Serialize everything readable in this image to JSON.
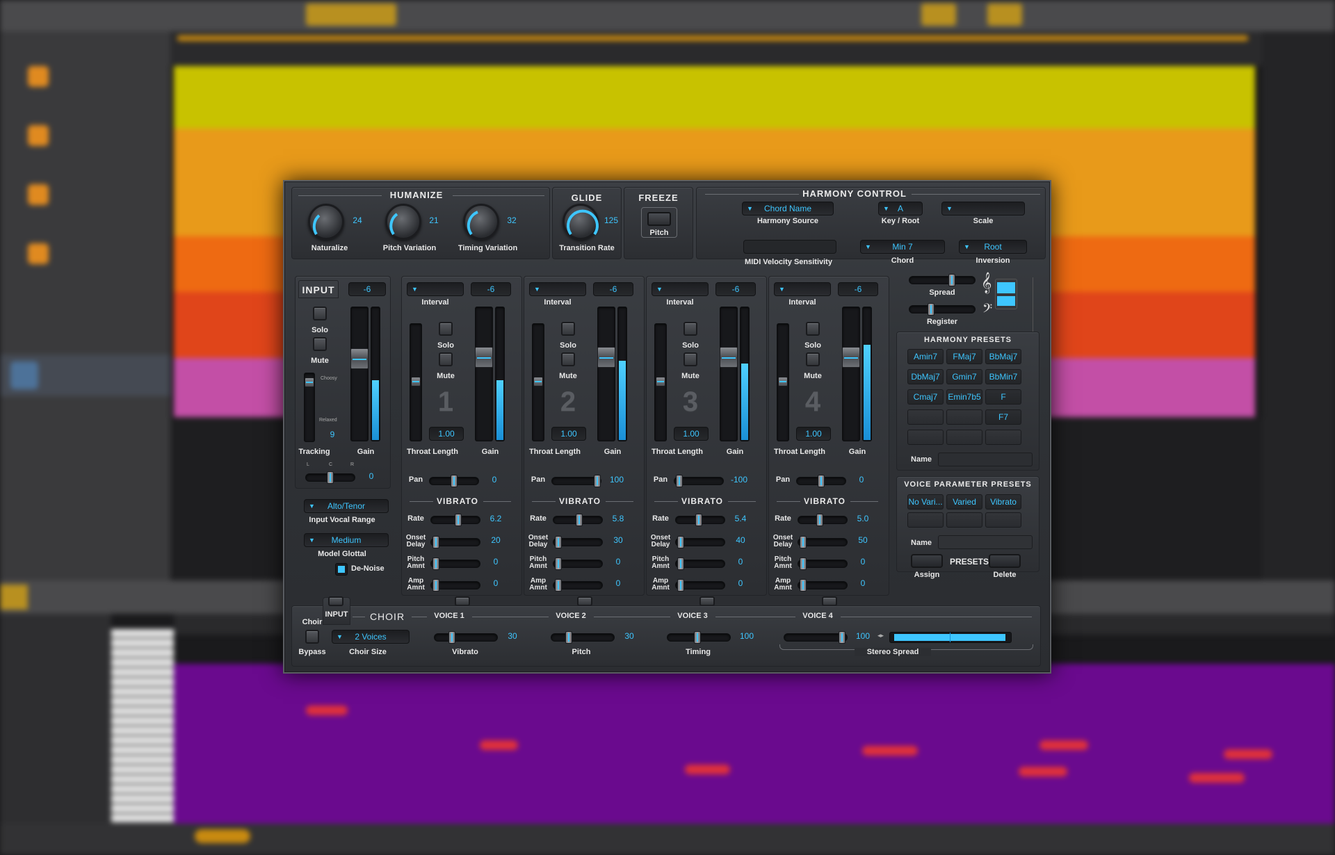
{
  "humanize": {
    "title": "HUMANIZE",
    "knobs": [
      {
        "label": "Naturalize",
        "value": "24"
      },
      {
        "label": "Pitch Variation",
        "value": "21"
      },
      {
        "label": "Timing Variation",
        "value": "32"
      }
    ]
  },
  "glide": {
    "title": "GLIDE",
    "label": "Transition Rate",
    "value": "125"
  },
  "freeze": {
    "title": "FREEZE",
    "label": "Pitch"
  },
  "harmony": {
    "title": "HARMONY CONTROL",
    "source": {
      "value": "Chord Name",
      "label": "Harmony Source"
    },
    "key": {
      "value": "A",
      "label": "Key / Root"
    },
    "scale": {
      "value": "",
      "label": "Scale"
    },
    "midi_label": "MIDI Velocity Sensitivity",
    "chord": {
      "value": "Min 7",
      "label": "Chord"
    },
    "inversion": {
      "value": "Root",
      "label": "Inversion"
    },
    "spread_label": "Spread",
    "register_label": "Register"
  },
  "input": {
    "title": "INPUT",
    "gain_value": "-6",
    "solo": "Solo",
    "mute": "Mute",
    "choosy": "Choosy",
    "relaxed": "Relaxed",
    "tracking_value": "9",
    "tracking_label": "Tracking",
    "gain_label": "Gain",
    "pan_value": "0",
    "vocal_range": {
      "value": "Alto/Tenor",
      "label": "Input Vocal Range"
    },
    "model": {
      "value": "Medium",
      "label": "Model Glottal"
    },
    "denoise": "De-Noise",
    "lcr": [
      "L",
      "C",
      "R"
    ]
  },
  "voices": [
    {
      "num": "1",
      "gain": "-6",
      "throat": "1.00",
      "pan": "0",
      "rate": "6.2",
      "onset": "20",
      "pitch_amnt": "0",
      "amp_amnt": "0",
      "gain_level": 0.45
    },
    {
      "num": "2",
      "gain": "-6",
      "throat": "1.00",
      "pan": "100",
      "rate": "5.8",
      "onset": "30",
      "pitch_amnt": "0",
      "amp_amnt": "0",
      "gain_level": 0.6
    },
    {
      "num": "3",
      "gain": "-6",
      "throat": "1.00",
      "pan": "-100",
      "rate": "5.4",
      "onset": "40",
      "pitch_amnt": "0",
      "amp_amnt": "0",
      "gain_level": 0.58
    },
    {
      "num": "4",
      "gain": "-6",
      "throat": "1.00",
      "pan": "0",
      "rate": "5.0",
      "onset": "50",
      "pitch_amnt": "0",
      "amp_amnt": "0",
      "gain_level": 0.72
    }
  ],
  "voice_labels": {
    "interval": "Interval",
    "solo": "Solo",
    "mute": "Mute",
    "throat": "Throat Length",
    "gain": "Gain",
    "pan": "Pan",
    "vibrato": "VIBRATO",
    "rate": "Rate",
    "onset1": "Onset",
    "onset2": "Delay",
    "pitch1": "Pitch",
    "pitch2": "Amnt",
    "amp1": "Amp",
    "amp2": "Amnt"
  },
  "harmony_presets": {
    "title": "HARMONY PRESETS",
    "items": [
      "Amin7",
      "FMaj7",
      "BbMaj7",
      "DbMaj7",
      "Gmin7",
      "BbMin7",
      "Cmaj7",
      "Emin7b5",
      "F",
      "",
      "",
      "F7",
      "",
      "",
      ""
    ],
    "name_label": "Name"
  },
  "voice_param_presets": {
    "title": "VOICE PARAMETER PRESETS",
    "items": [
      "No Vari...",
      "Varied",
      "Vibrato",
      "",
      "",
      ""
    ],
    "name_label": "Name",
    "assign": "Assign",
    "presets": "PRESETS",
    "delete": "Delete"
  },
  "choir": {
    "title": "CHOIR",
    "input_label": "INPUT",
    "choir_label": "Choir",
    "bypass": "Bypass",
    "size": {
      "value": "2 Voices",
      "label": "Choir Size"
    },
    "voice_heads": [
      "VOICE 1",
      "VOICE 2",
      "VOICE 3",
      "VOICE 4"
    ],
    "vibrato": {
      "label": "Vibrato",
      "value": "30"
    },
    "pitch": {
      "label": "Pitch",
      "value": "30"
    },
    "timing": {
      "label": "Timing",
      "value": "100"
    },
    "stereo": {
      "label": "Stereo Spread",
      "value": "100"
    }
  },
  "colors": {
    "accent": "#3ec6ff",
    "track_yellow": "#c8c200",
    "track_orange": "#e89a1a",
    "track_red": "#e0451a",
    "track_pink": "#c34fa6",
    "piano_roll": "#6a0a8e"
  }
}
